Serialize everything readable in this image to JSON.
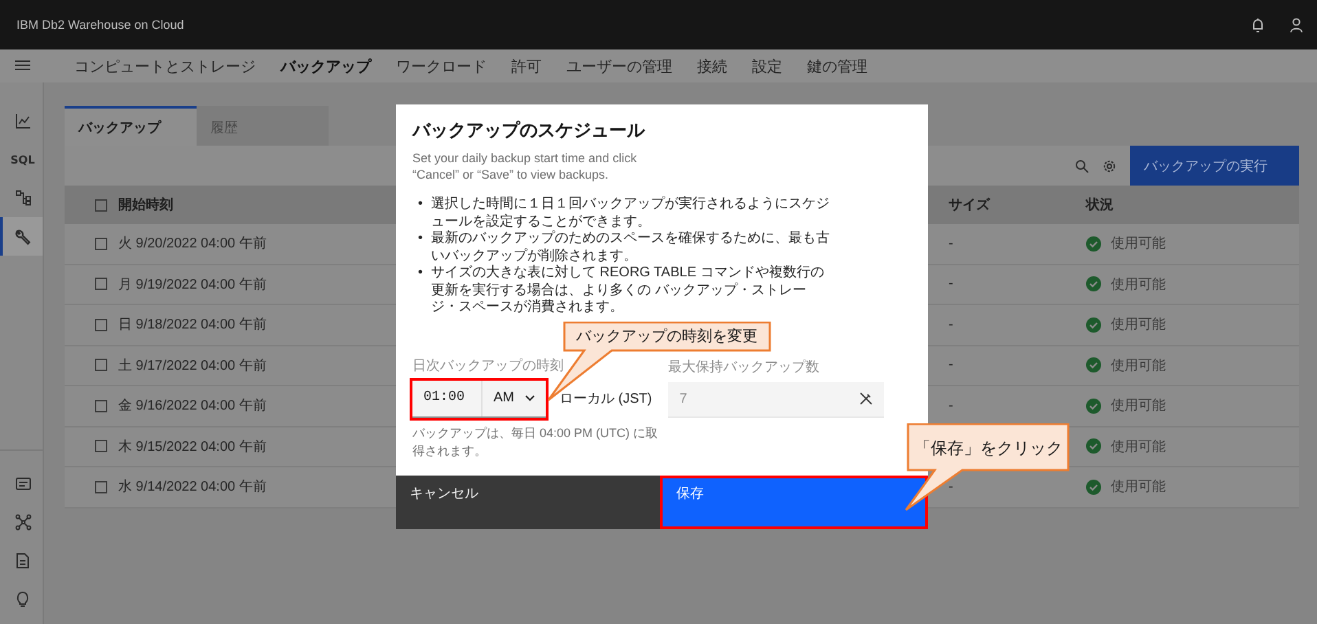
{
  "header": {
    "product": "IBM Db2 Warehouse on Cloud"
  },
  "nav": {
    "items": [
      {
        "label": "コンピュートとストレージ",
        "selected": false
      },
      {
        "label": "バックアップ",
        "selected": true
      },
      {
        "label": "ワークロード",
        "selected": false
      },
      {
        "label": "許可",
        "selected": false
      },
      {
        "label": "ユーザーの管理",
        "selected": false
      },
      {
        "label": "接続",
        "selected": false
      },
      {
        "label": "設定",
        "selected": false
      },
      {
        "label": "鍵の管理",
        "selected": false
      }
    ]
  },
  "sidebar": {
    "items": [
      {
        "kind": "chart",
        "selected": false
      },
      {
        "kind": "sql",
        "label": "SQL",
        "selected": false
      },
      {
        "kind": "tree",
        "selected": false
      },
      {
        "kind": "wrench",
        "selected": true
      }
    ],
    "bottom_items": [
      {
        "kind": "panel"
      },
      {
        "kind": "network"
      },
      {
        "kind": "document"
      },
      {
        "kind": "bulb"
      }
    ]
  },
  "tabs": [
    {
      "label": "バックアップ",
      "selected": true
    },
    {
      "label": "履歴",
      "selected": false
    }
  ],
  "toolbar": {
    "run_button": "バックアップの実行"
  },
  "table": {
    "columns": [
      "開始時刻",
      "サイズ",
      "状況"
    ],
    "header_checked": false,
    "rows": [
      {
        "start": "火 9/20/2022 04:00 午前",
        "size": "-",
        "status": "使用可能",
        "checked": false
      },
      {
        "start": "月 9/19/2022 04:00 午前",
        "size": "-",
        "status": "使用可能",
        "checked": false
      },
      {
        "start": "日 9/18/2022 04:00 午前",
        "size": "-",
        "status": "使用可能",
        "checked": false
      },
      {
        "start": "土 9/17/2022 04:00 午前",
        "size": "-",
        "status": "使用可能",
        "checked": false
      },
      {
        "start": "金 9/16/2022 04:00 午前",
        "size": "-",
        "status": "使用可能",
        "checked": false
      },
      {
        "start": "木 9/15/2022 04:00 午前",
        "status": "使用可能",
        "checked": false
      },
      {
        "start": "水 9/14/2022 04:00 午前",
        "size": "-",
        "status": "使用可能",
        "checked": false
      }
    ]
  },
  "dialog": {
    "title": "バックアップのスケジュール",
    "subtitle": "Set your daily backup start time and click “Cancel” or “Save” to view backups.",
    "bullets": [
      {
        "marker": "•",
        "text": "選択した時間に１日１回バックアップが実行されるようにスケジュールを設定することができます。"
      },
      {
        "marker": "•",
        "text": "最新のバックアップのためのスペースを確保するために、最も古いバックアップが削除されます。"
      },
      {
        "marker": "•",
        "text": "サイズの大きな表に対して REORG TABLE コマンドや複数行の更新を実行する場合は、より多くの バックアップ・ストレージ・スペースが消費されます。"
      }
    ],
    "time_label": "日次バックアップの時刻",
    "time_value": "01:00",
    "ampm": "AM",
    "timezone": "ローカル (JST)",
    "retention_label": "最大保持バックアップ数",
    "retention_value": "7",
    "retention_disabled": true,
    "helper": "バックアップは、毎日 04:00 PM (UTC) に取得されます。",
    "cancel": "キャンセル",
    "save": "保存"
  },
  "callouts": [
    {
      "text": "バックアップの時刻を変更"
    },
    {
      "text": "「保存」をクリック"
    }
  ]
}
